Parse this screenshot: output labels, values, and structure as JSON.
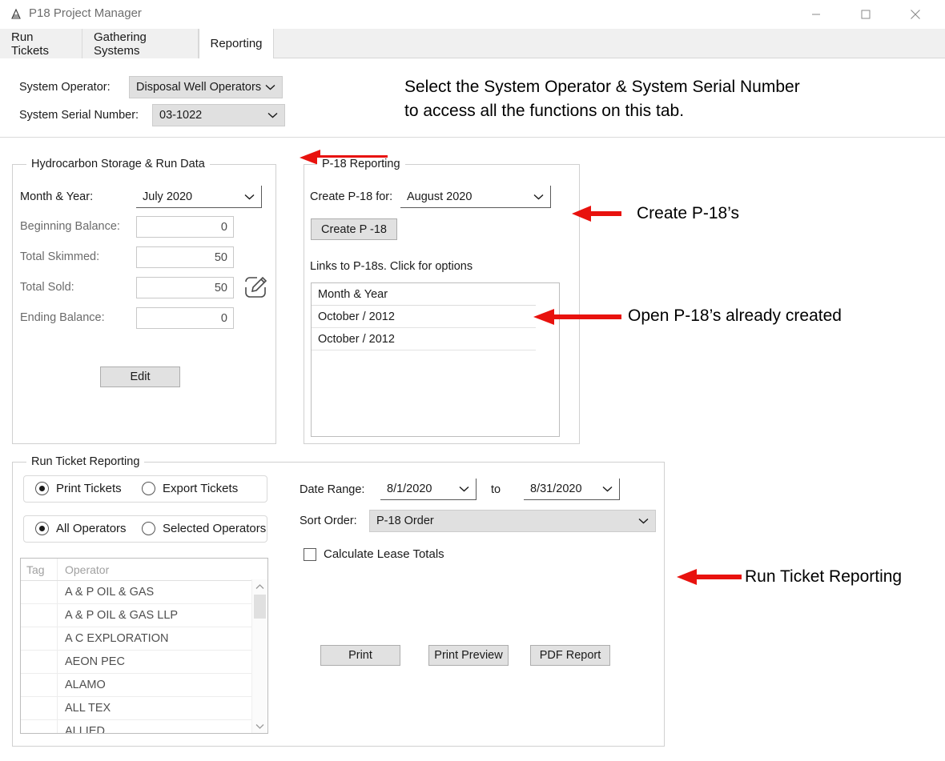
{
  "window": {
    "title": "P18 Project Manager",
    "icon": "app-icon",
    "controls": {
      "minimize": "minimize-icon",
      "maximize": "maximize-icon",
      "close": "close-icon"
    }
  },
  "tabs": [
    {
      "label": "Run Tickets",
      "active": false
    },
    {
      "label": "Gathering Systems",
      "active": false
    },
    {
      "label": "Reporting",
      "active": true
    }
  ],
  "header": {
    "operator_label": "System Operator:",
    "operator_value": "Disposal Well Operators",
    "serial_label": "System Serial Number:",
    "serial_value": "03-1022"
  },
  "hydrocarbon": {
    "legend": "Hydrocarbon Storage & Run Data",
    "month_label": "Month & Year:",
    "month_value": "July 2020",
    "fields": [
      {
        "label": "Beginning Balance:",
        "value": "0"
      },
      {
        "label": "Total Skimmed:",
        "value": "50"
      },
      {
        "label": "Total Sold:",
        "value": "50"
      },
      {
        "label": "Ending Balance:",
        "value": "0"
      }
    ],
    "edit_icon": "pencil-edit-icon",
    "edit_button": "Edit"
  },
  "p18": {
    "legend": "P-18 Reporting",
    "create_for_label": "Create P-18 for:",
    "create_for_value": "August 2020",
    "create_button": "Create P -18",
    "links_label": "Links to P-18s.  Click for options",
    "list_header": "Month & Year",
    "list_items": [
      "October / 2012",
      "October / 2012"
    ]
  },
  "run_ticket": {
    "legend": "Run Ticket Reporting",
    "mode_options": [
      {
        "label": "Print Tickets",
        "checked": true
      },
      {
        "label": "Export Tickets",
        "checked": false
      }
    ],
    "scope_options": [
      {
        "label": "All Operators",
        "checked": true
      },
      {
        "label": "Selected Operators",
        "checked": false
      }
    ],
    "grid_headers": [
      "Tag",
      "Operator"
    ],
    "operators": [
      "A & P OIL & GAS",
      "A & P OIL & GAS  LLP",
      "A C EXPLORATION",
      "AEON PEC",
      "ALAMO",
      "ALL TEX",
      "ALLIED"
    ],
    "date_range_label": "Date Range:",
    "date_from": "8/1/2020",
    "date_to_label": "to",
    "date_to": "8/31/2020",
    "sort_order_label": "Sort Order:",
    "sort_order_value": "P-18 Order",
    "calculate_lease_totals": "Calculate Lease Totals",
    "buttons": [
      "Print",
      "Print Preview",
      "PDF Report"
    ]
  },
  "annotations": {
    "select_note_line1": "Select the System Operator & System Serial Number",
    "select_note_line2": "to access all the functions on this tab.",
    "create_p18": "Create P-18’s",
    "open_p18": "Open P-18’s already created",
    "run_ticket_reporting": "Run Ticket Reporting",
    "arrow_color": "#e8120e"
  }
}
